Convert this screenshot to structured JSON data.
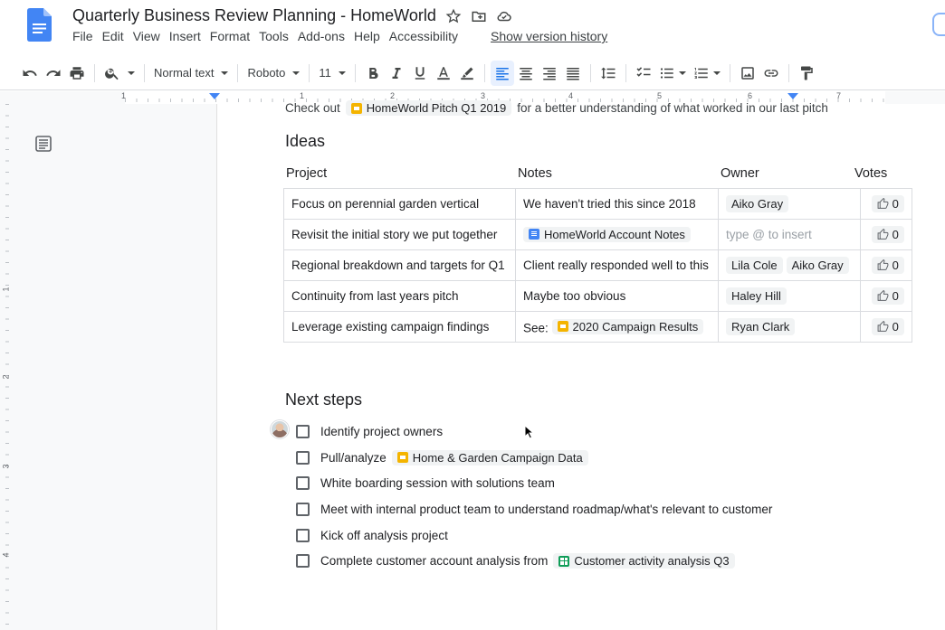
{
  "doc": {
    "title": "Quarterly Business Review Planning - HomeWorld"
  },
  "menu": {
    "items": [
      "File",
      "Edit",
      "View",
      "Insert",
      "Format",
      "Tools",
      "Add-ons",
      "Help",
      "Accessibility"
    ],
    "version_history": "Show version history"
  },
  "toolbar": {
    "style": "Normal text",
    "font": "Roboto",
    "size": "11"
  },
  "ruler": {
    "h_numbers": [
      "1",
      "1",
      "2",
      "3",
      "4",
      "5",
      "6",
      "7"
    ],
    "v_numbers": [
      "1",
      "2",
      "3",
      "4"
    ]
  },
  "body": {
    "intro_prefix": "Check out",
    "intro_chip": "HomeWorld Pitch Q1 2019",
    "intro_suffix": "for a better understanding of what worked in our last pitch",
    "ideas_heading": "Ideas",
    "columns": [
      "Project",
      "Notes",
      "Owner",
      "Votes"
    ],
    "rows": [
      {
        "project": "Focus on perennial garden vertical",
        "notes_prefix": "",
        "notes": "We haven't tried this since 2018",
        "notes_chip": "",
        "owners": [
          "Aiko Gray"
        ],
        "owner_placeholder": "",
        "votes": "0"
      },
      {
        "project": "Revisit the initial story we put together",
        "notes_prefix": "",
        "notes": "",
        "notes_chip": "HomeWorld Account Notes",
        "owners": [],
        "owner_placeholder": "type @ to insert",
        "votes": "0"
      },
      {
        "project": "Regional breakdown and targets for Q1",
        "notes_prefix": "",
        "notes": "Client really responded well to this",
        "notes_chip": "",
        "owners": [
          "Lila Cole",
          "Aiko Gray"
        ],
        "owner_placeholder": "",
        "votes": "0"
      },
      {
        "project": "Continuity from last years pitch",
        "notes_prefix": "",
        "notes": "Maybe too obvious",
        "notes_chip": "",
        "owners": [
          "Haley Hill"
        ],
        "owner_placeholder": "",
        "votes": "0"
      },
      {
        "project": "Leverage existing campaign findings",
        "notes_prefix": "See:",
        "notes": "",
        "notes_chip": "2020 Campaign Results",
        "owners": [
          "Ryan Clark"
        ],
        "owner_placeholder": "",
        "votes": "0"
      }
    ],
    "next_heading": "Next steps",
    "steps": [
      {
        "text": "Identify project owners",
        "chip": "",
        "chip_type": ""
      },
      {
        "text": "Pull/analyze",
        "chip": "Home & Garden Campaign Data",
        "chip_type": "slides"
      },
      {
        "text": "White boarding session with solutions team",
        "chip": "",
        "chip_type": ""
      },
      {
        "text": "Meet with internal product team to understand roadmap/what's relevant to customer",
        "chip": "",
        "chip_type": ""
      },
      {
        "text": "Kick off analysis project",
        "chip": "",
        "chip_type": ""
      },
      {
        "text": "Complete customer account analysis from",
        "chip": "Customer activity analysis Q3",
        "chip_type": "sheets"
      }
    ]
  },
  "colors": {
    "docs_blue": "#4285f4",
    "slides_yellow": "#f4b400",
    "sheets_green": "#0f9d58",
    "active_bg": "#e8f0fe"
  }
}
